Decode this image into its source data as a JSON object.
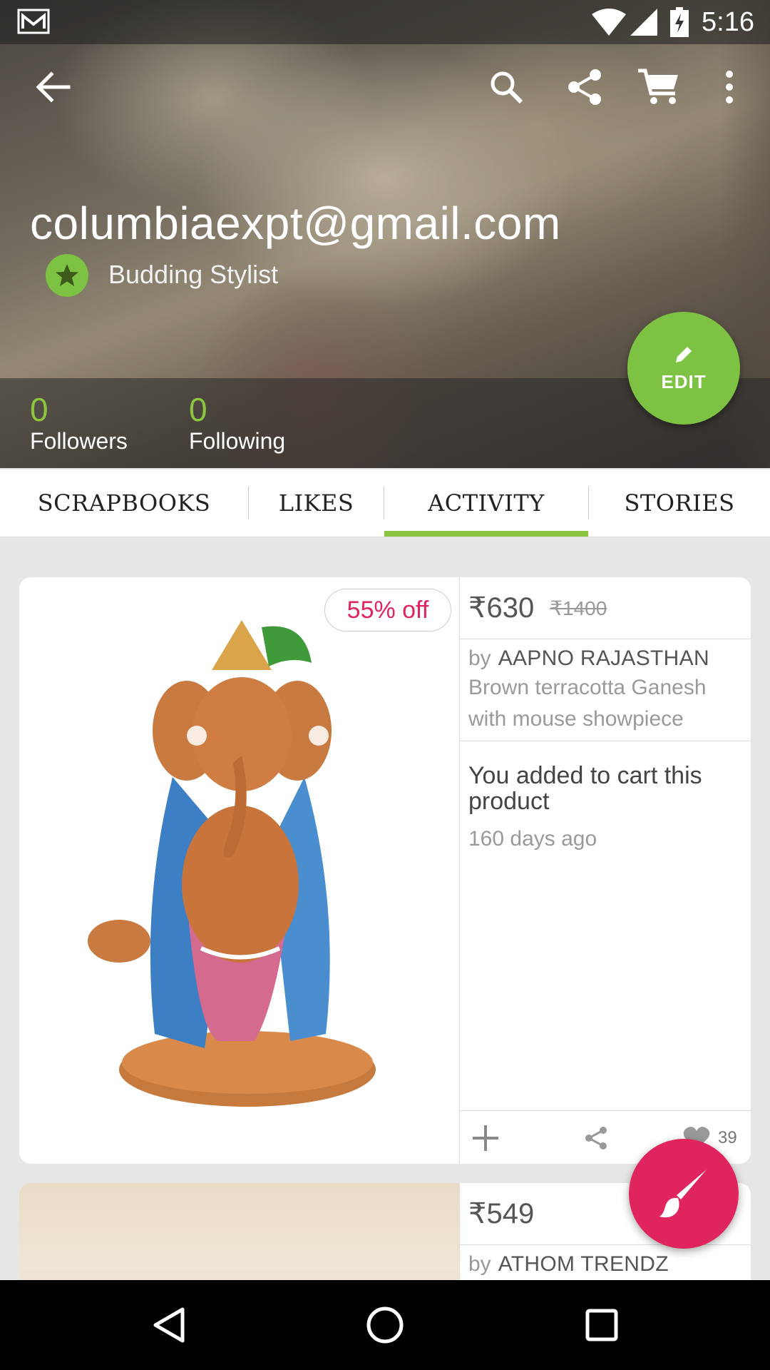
{
  "status_bar": {
    "time": "5:16"
  },
  "profile": {
    "email": "columbiaexpt@gmail.com",
    "badge_label": "Budding Stylist",
    "followers_count": "0",
    "followers_label": "Followers",
    "following_count": "0",
    "following_label": "Following",
    "edit_label": "EDIT"
  },
  "tabs": [
    {
      "label": "SCRAPBOOKS",
      "active": false
    },
    {
      "label": "LIKES",
      "active": false
    },
    {
      "label": "ACTIVITY",
      "active": true
    },
    {
      "label": "STORIES",
      "active": false
    }
  ],
  "cards": [
    {
      "discount": "55% off",
      "price": "₹630",
      "price_old": "₹1400",
      "by": "by",
      "seller": "AAPNO RAJASTHAN",
      "description": "Brown terracotta Ganesh with mouse showpiece",
      "activity": "You added to cart this product",
      "time": "160 days ago",
      "likes": "39"
    },
    {
      "price": "₹549",
      "by": "by",
      "seller": "ATHOM TRENDZ"
    }
  ],
  "colors": {
    "accent_green": "#8cc63f",
    "accent_pink": "#e0245e"
  },
  "icons": [
    "mail-icon",
    "wifi-icon",
    "signal-icon",
    "battery-icon",
    "back-arrow-icon",
    "search-icon",
    "share-icon",
    "cart-icon",
    "overflow-menu-icon",
    "star-icon",
    "pencil-icon",
    "add-icon",
    "heart-icon",
    "brush-icon",
    "nav-back-icon",
    "nav-home-icon",
    "nav-recents-icon"
  ]
}
